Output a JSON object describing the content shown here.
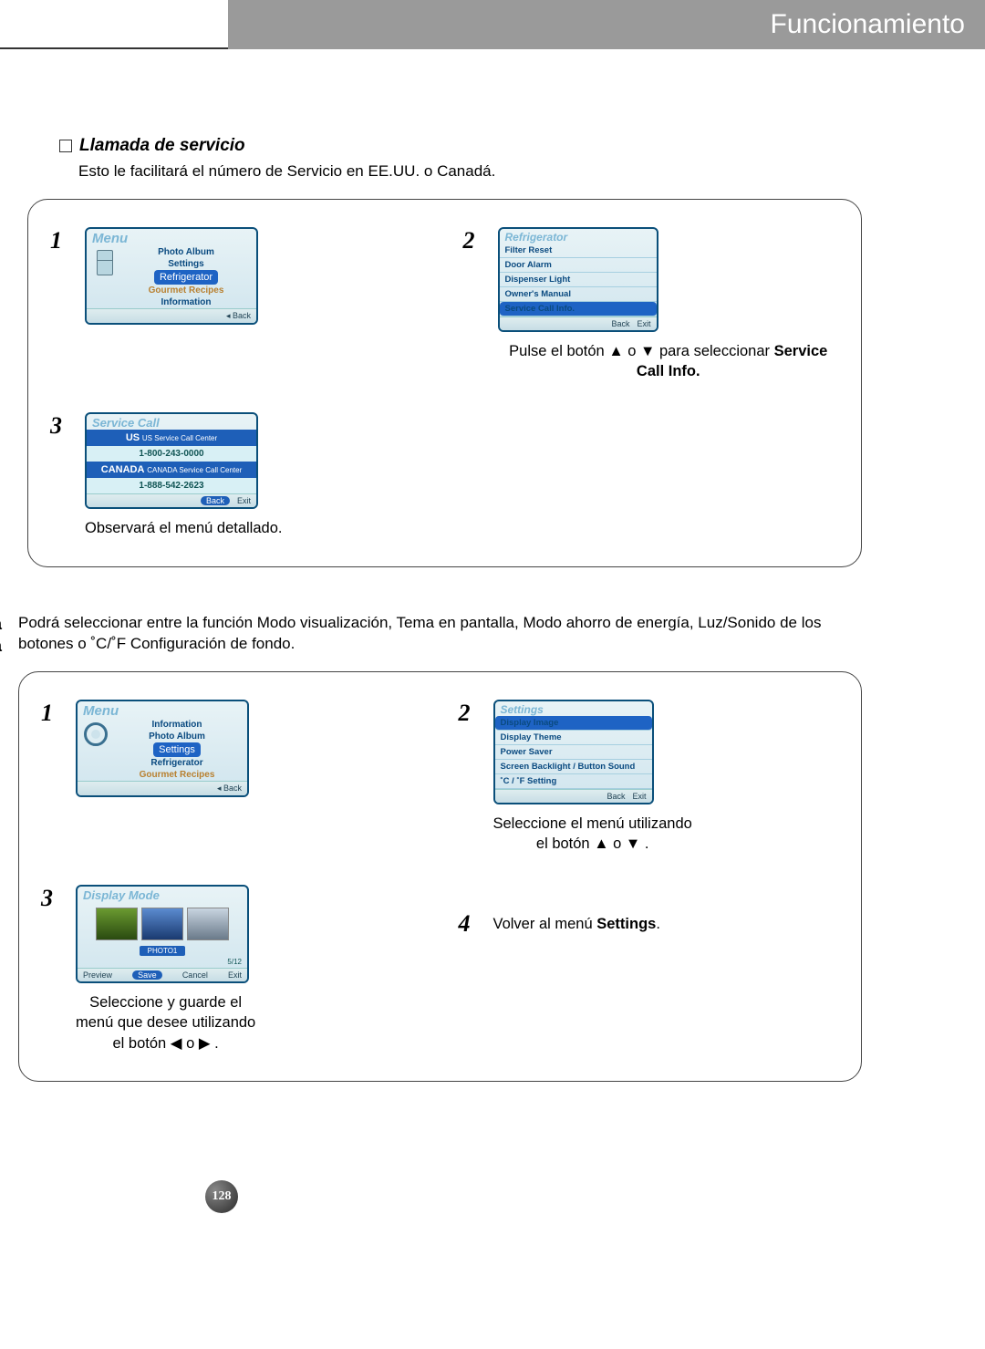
{
  "header": {
    "title": "Funcionamiento"
  },
  "pageNumber": "128",
  "section1": {
    "subheading": "Llamada de servicio",
    "intro": "Esto le facilitará el número de Servicio en EE.UU. o Canadá.",
    "step1": {
      "num": "1",
      "screen": {
        "title": "Menu",
        "items": [
          "Photo Album",
          "Settings"
        ],
        "selected": "Refrigerator",
        "itemsAfter": [
          "Gourmet Recipes",
          "Information"
        ],
        "backLabel": "◂ Back"
      }
    },
    "step2": {
      "num": "2",
      "screen": {
        "title": "Refrigerator",
        "items": [
          "Filter Reset",
          "Door Alarm",
          "Dispenser Light",
          "Owner's Manual"
        ],
        "selected": "Service Call Info.",
        "foot": {
          "back": "Back",
          "exit": "Exit"
        }
      },
      "caption_a": "Pulse el botón ",
      "caption_b": " o ",
      "caption_c": " para seleccionar ",
      "caption_bold": "Service Call Info."
    },
    "step3": {
      "num": "3",
      "screen": {
        "title": "Service Call",
        "us_label": "US Service Call Center",
        "us_phone": "1-800-243-0000",
        "ca_label": "CANADA Service Call Center",
        "ca_phone": "1-888-542-2623",
        "foot": {
          "back": "Back",
          "exit": "Exit"
        }
      },
      "caption": "Observará el menú detallado."
    }
  },
  "section2": {
    "sideHeading1": "Configuración de la",
    "sideHeading2": "pantalla",
    "intro": "Podrá seleccionar entre la función Modo visualización, Tema en pantalla, Modo ahorro de energía, Luz/Sonido de los botones o ˚C/˚F Configuración de fondo.",
    "step1": {
      "num": "1",
      "screen": {
        "title": "Menu",
        "items": [
          "Information",
          "Photo Album"
        ],
        "selected": "Settings",
        "itemsAfter": [
          "Refrigerator",
          "Gourmet Recipes"
        ],
        "backLabel": "◂ Back"
      }
    },
    "step2": {
      "num": "2",
      "screen": {
        "title": "Settings",
        "selected": "Display Image",
        "items": [
          "Display Theme",
          "Power Saver",
          "Screen Backlight / Button Sound",
          "˚C / ˚F Setting"
        ],
        "foot": {
          "back": "Back",
          "exit": "Exit"
        }
      },
      "caption_a": "Seleccione el menú utilizando",
      "caption_b": "el botón ",
      "caption_c": " o ",
      "caption_d": " ."
    },
    "step3": {
      "num": "3",
      "screen": {
        "title": "Display Mode",
        "photoLabel": "PHOTO1",
        "counter": "5/12",
        "foot": {
          "preview": "Preview",
          "save": "Save",
          "cancel": "Cancel",
          "exit": "Exit"
        }
      },
      "caption_a": "Seleccione y guarde el",
      "caption_b": "menú que desee utilizando",
      "caption_c": "el botón ",
      "caption_d": " o ",
      "caption_e": " ."
    },
    "step4": {
      "num": "4",
      "caption_a": "Volver al menú ",
      "caption_bold": "Settings",
      "caption_b": "."
    }
  }
}
